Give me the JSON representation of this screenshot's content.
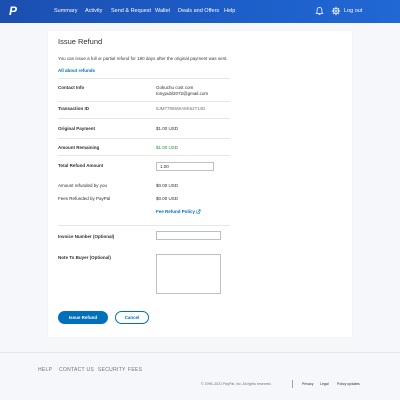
{
  "header": {
    "logo_text": "P",
    "nav": [
      "Summary",
      "Activity",
      "Send & Request",
      "Wallet",
      "Deals and Offers",
      "Help"
    ],
    "logout_label": "Log out"
  },
  "page": {
    "title": "Issue Refund",
    "subtitle": "You can issue a full or partial refund for 180 days after the original payment was sent.",
    "all_refunds_link": "All about refunds"
  },
  "details": {
    "contact_label": "Contact Info",
    "contact_name": "Gokuchu cost com",
    "contact_email": "tonypubl2072@gmail.com",
    "transaction_label": "Transaction ID",
    "transaction_value": "5JM77956WA8K62714D",
    "original_label": "Original Payment",
    "original_value": "$1.00 USD",
    "remaining_label": "Amount Remaining",
    "remaining_value": "$1.00 USD",
    "total_refund_label": "Total Refund Amount",
    "total_refund_value": "1.00",
    "refunded_by_you_label": "Amount refunded by you",
    "refunded_by_you_value": "$0.00 USD",
    "fees_label": "Fees Refunded by PayPal",
    "fees_value": "$0.00 USD",
    "fee_policy_link": "Fee Refund Policy",
    "invoice_label": "Invoice Number (Optional)",
    "invoice_value": "",
    "note_label": "Note To Buyer (Optional)",
    "note_value": ""
  },
  "actions": {
    "issue_label": "Issue Refund",
    "cancel_label": "Cancel"
  },
  "footer": {
    "links": [
      "HELP",
      "CONTACT US",
      "SECURITY",
      "FEES"
    ],
    "copyright": "© 1999–2021 PayPal, Inc. All rights reserved.",
    "privacy": "Privacy",
    "legal": "Legal",
    "policy_updates": "Policy updates"
  },
  "colors": {
    "header_blue": "#1d5ec9",
    "link_blue": "#0070ba",
    "button_blue": "#0070ba"
  },
  "icons": {
    "bell": "bell-icon",
    "settings": "gear-icon",
    "external": "external-link-icon"
  }
}
